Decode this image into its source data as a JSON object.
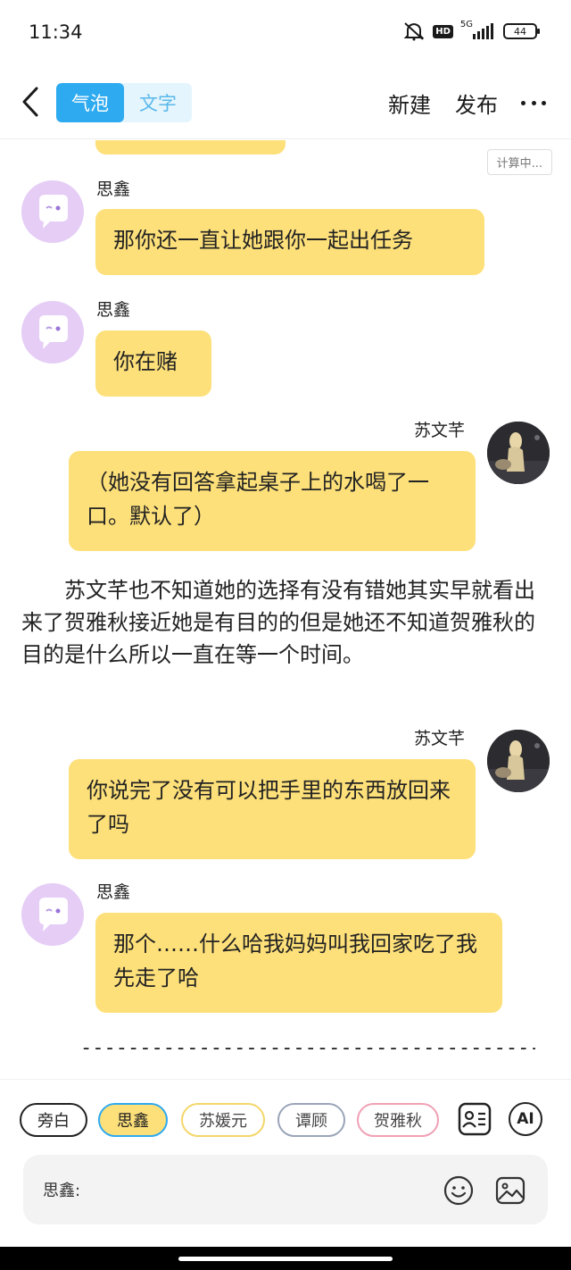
{
  "status_bar": {
    "time": "11:34",
    "network": "5G",
    "hd": "HD",
    "battery": "44",
    "icons": [
      "mute-icon",
      "hd-icon",
      "signal-icon",
      "battery-icon"
    ]
  },
  "header": {
    "back_icon": "chevron-left-icon",
    "mode_tabs": [
      {
        "label": "气泡",
        "active": true
      },
      {
        "label": "文字",
        "active": false
      }
    ],
    "new_label": "新建",
    "publish_label": "发布",
    "more_icon": "more-horizontal-icon",
    "accent": "#2eaaf0"
  },
  "chat": {
    "calc_badge": "计算中...",
    "bubble_color": "#fde07a",
    "messages": [
      {
        "sender": "思鑫",
        "side": "left",
        "text": "那你还一直让她跟你一起出任务"
      },
      {
        "sender": "思鑫",
        "side": "left",
        "text": "你在赌"
      },
      {
        "sender": "苏文芊",
        "side": "right",
        "text": "（她没有回答拿起桌子上的水喝了一口。默认了）"
      },
      {
        "sender": "苏文芊",
        "side": "right",
        "text": "你说完了没有可以把手里的东西放回来了吗"
      },
      {
        "sender": "思鑫",
        "side": "left",
        "text": "那个……什么哈我妈妈叫我回家吃了我先走了哈"
      }
    ],
    "narration": "苏文芊也不知道她的选择有没有错她其实早就看出来了贺雅秋接近她是有目的的但是她还不知道贺雅秋的目的是什么所以一直在等一个时间。",
    "divider": "----------------------------------------"
  },
  "bottom": {
    "chips": [
      "旁白",
      "思鑫",
      "苏媛元",
      "谭顾",
      "贺雅秋"
    ],
    "selected_chip": "思鑫",
    "roles_icon": "character-card-icon",
    "ai_label": "AI",
    "input_prefix": "思鑫:",
    "input_value": "",
    "emoji_icon": "emoji-icon",
    "image_icon": "image-icon"
  }
}
